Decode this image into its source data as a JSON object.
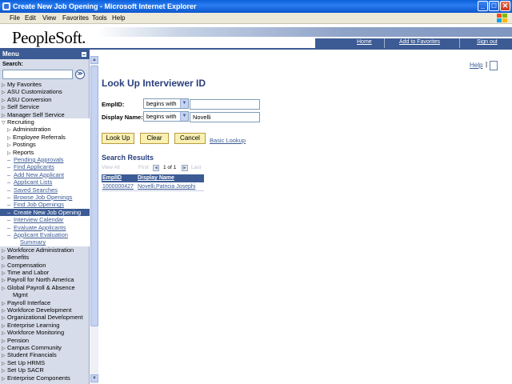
{
  "window": {
    "title": "Create New Job Opening - Microsoft Internet Explorer",
    "controls": [
      "_",
      "□",
      "✕"
    ]
  },
  "menubar": [
    "File",
    "Edit",
    "View",
    "Favorites",
    "Tools",
    "Help"
  ],
  "header": {
    "logo": "PeopleSoft.",
    "nav": [
      "Home",
      "Add to Favorites",
      "Sign out"
    ]
  },
  "menu": {
    "title": "Menu",
    "search_label": "Search:",
    "search_value": "",
    "go_glyph": "≫",
    "items": [
      {
        "label": "My Favorites",
        "type": "folder"
      },
      {
        "label": "ASU Customizations",
        "type": "folder"
      },
      {
        "label": "ASU Conversion",
        "type": "folder"
      },
      {
        "label": "Self Service",
        "type": "folder"
      },
      {
        "label": "Manager Self Service",
        "type": "folder"
      },
      {
        "label": "Recruiting",
        "type": "open"
      },
      {
        "label": "Administration",
        "type": "subfolder"
      },
      {
        "label": "Employee Referrals",
        "type": "subfolder"
      },
      {
        "label": "Postings",
        "type": "subfolder"
      },
      {
        "label": "Reports",
        "type": "subfolder"
      },
      {
        "label": "Pending Approvals",
        "type": "link"
      },
      {
        "label": "Find Applicants",
        "type": "link"
      },
      {
        "label": "Add New Applicant",
        "type": "link"
      },
      {
        "label": "Applicant Lists",
        "type": "link"
      },
      {
        "label": "Saved Searches",
        "type": "link"
      },
      {
        "label": "Browse Job Openings",
        "type": "link"
      },
      {
        "label": "Find Job Openings",
        "type": "link"
      },
      {
        "label": "Create New Job Opening",
        "type": "selected"
      },
      {
        "label": "Interview Calendar",
        "type": "link"
      },
      {
        "label": "Evaluate Applicants",
        "type": "link"
      },
      {
        "label": "Applicant Evaluation",
        "type": "link"
      },
      {
        "label": "Summary",
        "type": "link-cont"
      },
      {
        "label": "Workforce Administration",
        "type": "folder"
      },
      {
        "label": "Benefits",
        "type": "folder"
      },
      {
        "label": "Compensation",
        "type": "folder"
      },
      {
        "label": "Time and Labor",
        "type": "folder"
      },
      {
        "label": "Payroll for North America",
        "type": "folder"
      },
      {
        "label": "Global Payroll & Absence",
        "type": "folder"
      },
      {
        "label": "Mgmt",
        "type": "cont"
      },
      {
        "label": "Payroll Interface",
        "type": "folder"
      },
      {
        "label": "Workforce Development",
        "type": "folder"
      },
      {
        "label": "Organizational Development",
        "type": "folder"
      },
      {
        "label": "Enterprise Learning",
        "type": "folder"
      },
      {
        "label": "Workforce Monitoring",
        "type": "folder"
      },
      {
        "label": "Pension",
        "type": "folder"
      },
      {
        "label": "Campus Community",
        "type": "folder"
      },
      {
        "label": "Student Financials",
        "type": "folder"
      },
      {
        "label": "Set Up HRMS",
        "type": "folder"
      },
      {
        "label": "Set Up SACR",
        "type": "folder"
      },
      {
        "label": "Enterprise Components",
        "type": "folder"
      }
    ]
  },
  "content": {
    "help_label": "Help",
    "help_sep": "|",
    "page_title": "Look Up Interviewer ID",
    "fields": [
      {
        "label": "EmplID:",
        "operator": "begins with",
        "value": ""
      },
      {
        "label": "Display Name:",
        "operator": "begins with",
        "value": "Novelli"
      }
    ],
    "buttons": {
      "lookup": "Look Up",
      "clear": "Clear",
      "cancel": "Cancel"
    },
    "basic_lookup": "Basic Lookup",
    "results": {
      "title": "Search Results",
      "view_all": "View All",
      "first": "First",
      "count": "1 of 1",
      "last": "Last",
      "columns": [
        "EmplID",
        "Display Name"
      ],
      "rows": [
        {
          "emplid": "1000000427",
          "name": "Novelli,Patricia Josephi"
        }
      ]
    }
  }
}
